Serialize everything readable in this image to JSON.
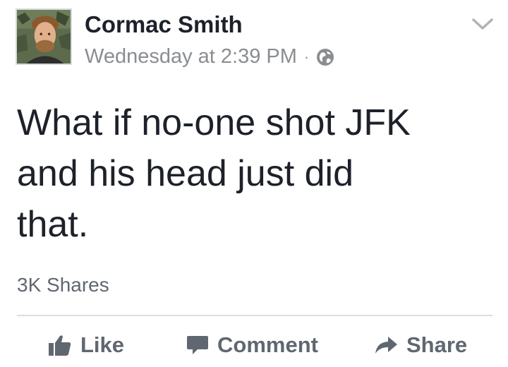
{
  "post": {
    "author": "Cormac Smith",
    "timestamp": "Wednesday at 2:39 PM",
    "separator": "·",
    "privacy_icon": "globe-icon",
    "menu_icon": "chevron-down-icon",
    "text_lines": [
      "What if no-one shot JFK",
      "and his head just did",
      "that."
    ],
    "share_count": "3K Shares"
  },
  "actions": {
    "like": {
      "label": "Like",
      "icon": "thumbs-up-icon"
    },
    "comment": {
      "label": "Comment",
      "icon": "speech-bubble-icon"
    },
    "share": {
      "label": "Share",
      "icon": "share-arrow-icon"
    }
  },
  "colors": {
    "text": "#1d2129",
    "meta": "#8a8d91",
    "action": "#606770",
    "divider": "#dadde1"
  }
}
